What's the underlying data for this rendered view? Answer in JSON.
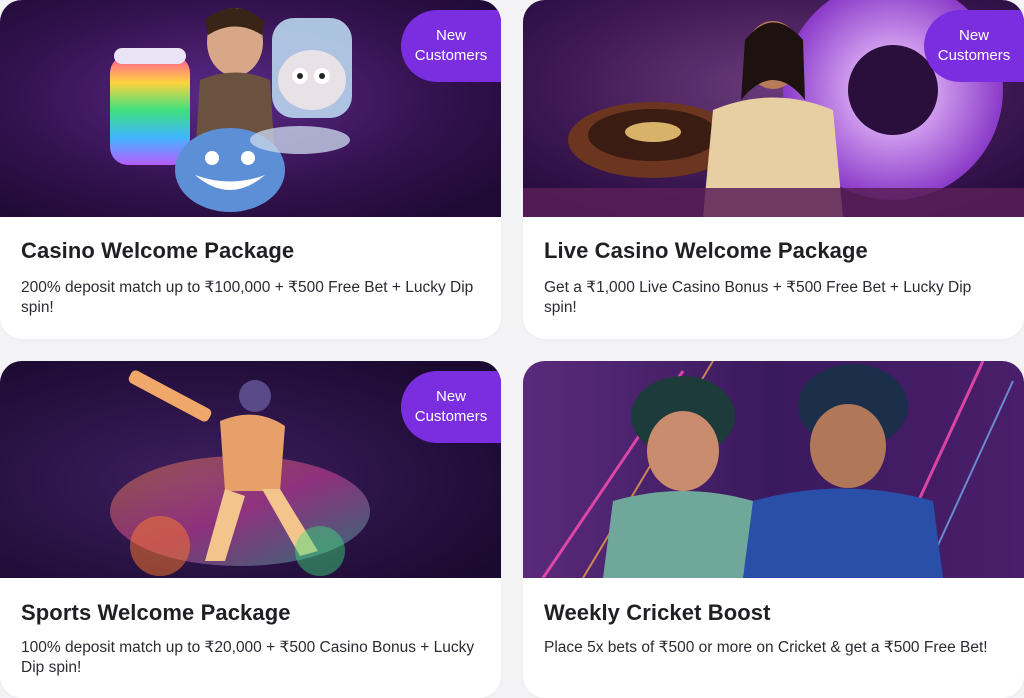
{
  "cards": [
    {
      "title": "Casino Welcome Package",
      "description": "200% deposit match up to ₹100,000 + ₹500 Free Bet + Lucky Dip spin!",
      "badge_line1": "New",
      "badge_line2": "Customers"
    },
    {
      "title": "Live Casino Welcome Package",
      "description": "Get a ₹1,000 Live Casino Bonus + ₹500 Free Bet + Lucky Dip spin!",
      "badge_line1": "New",
      "badge_line2": "Customers"
    },
    {
      "title": "Sports Welcome Package",
      "description": "100% deposit match up to ₹20,000 + ₹500 Casino Bonus + Lucky Dip spin!",
      "badge_line1": "New",
      "badge_line2": "Customers"
    },
    {
      "title": "Weekly Cricket Boost",
      "description": "Place 5x bets of ₹500 or more on Cricket & get a ₹500 Free Bet!"
    }
  ],
  "colors": {
    "badge": "#7a2ee0",
    "card_background": "#ffffff",
    "page_background": "#f3f3f5",
    "hero_dark_purple": "#2a0d45"
  },
  "illustrations": [
    "casino-characters-illustration",
    "live-dealer-roulette-illustration",
    "neon-cricket-batsman-illustration",
    "cricket-players-neon-illustration"
  ]
}
